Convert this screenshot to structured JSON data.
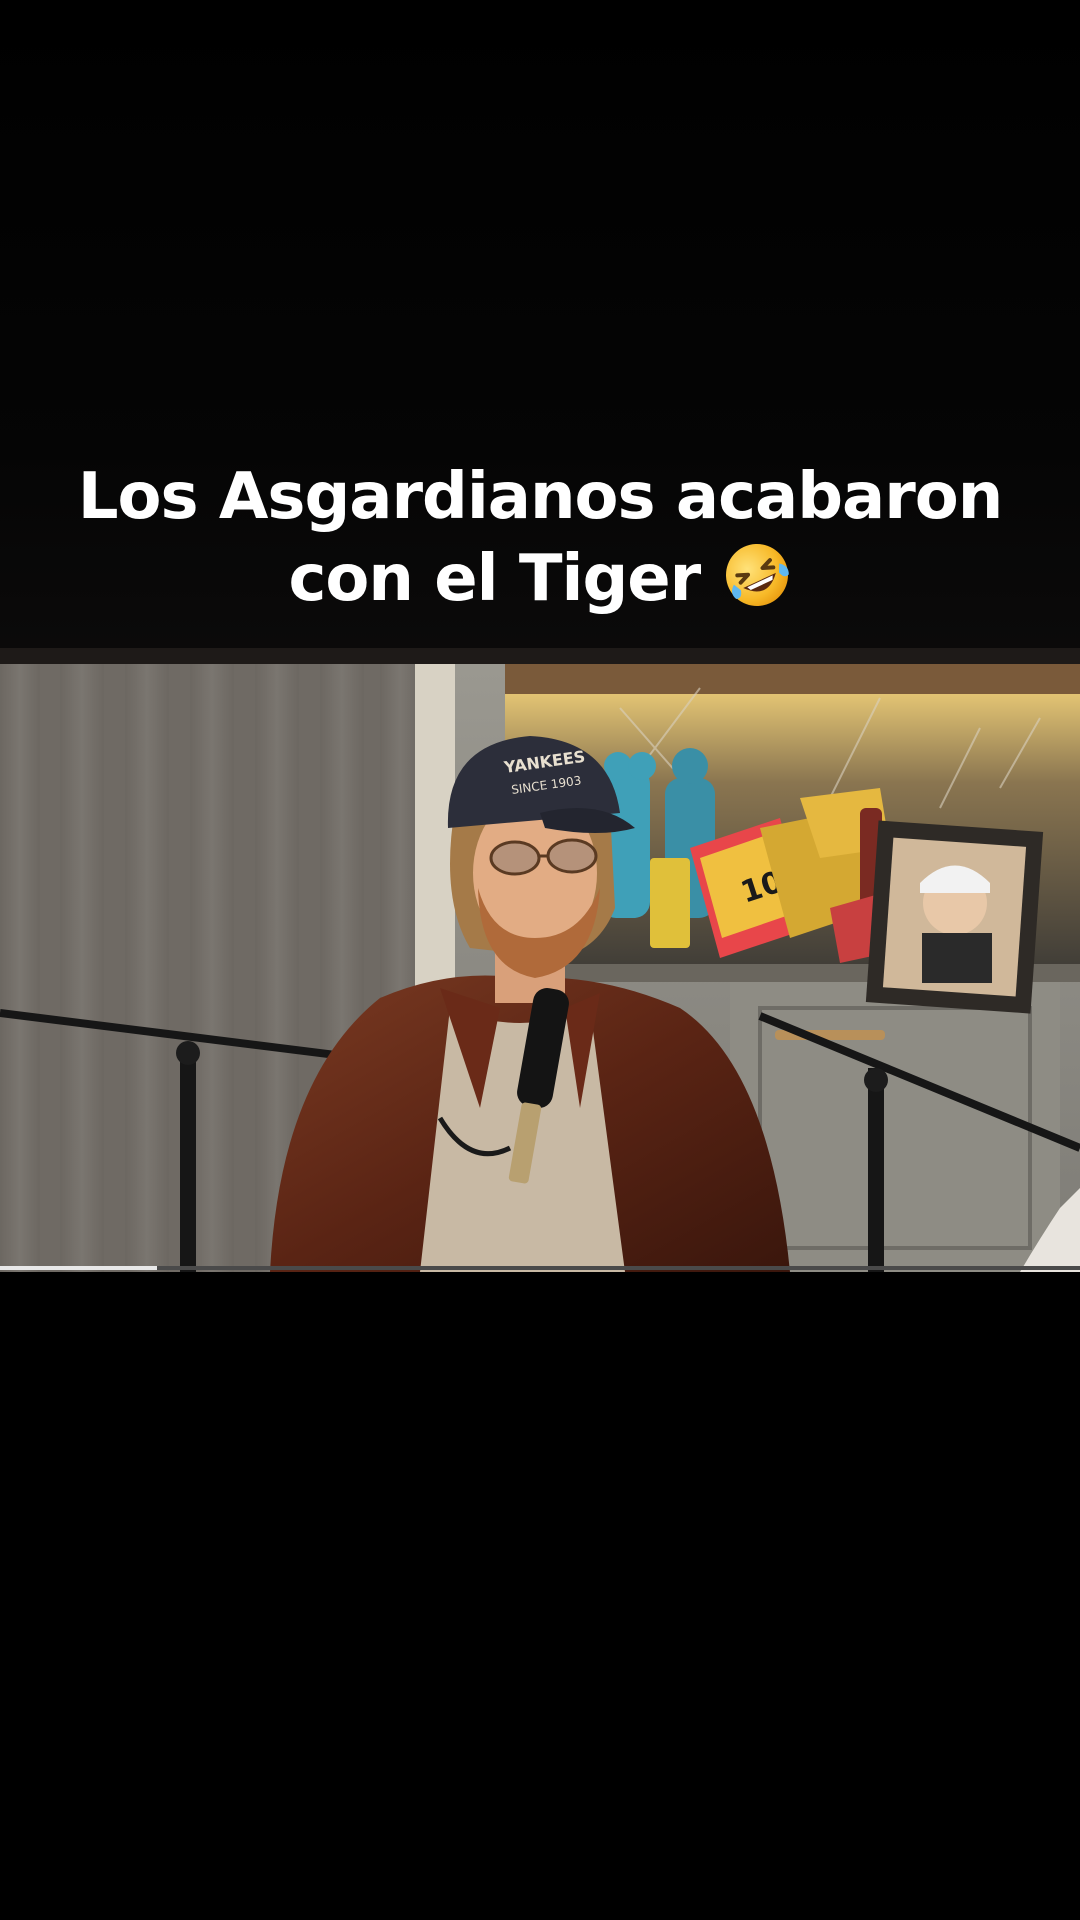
{
  "caption": {
    "line1": "Los Asgardianos acabaron",
    "line2": "con el Tiger",
    "emoji": "rolling-on-the-floor-laughing"
  },
  "video": {
    "cap_text": "YANKEES",
    "cap_subtext": "SINCE 1903",
    "figure_text": "1000",
    "progress": 0.145
  },
  "colors": {
    "background": "#000000",
    "caption_text": "#ffffff",
    "progress_fill": "#e8e8e8",
    "progress_track": "#4a4a4a"
  }
}
